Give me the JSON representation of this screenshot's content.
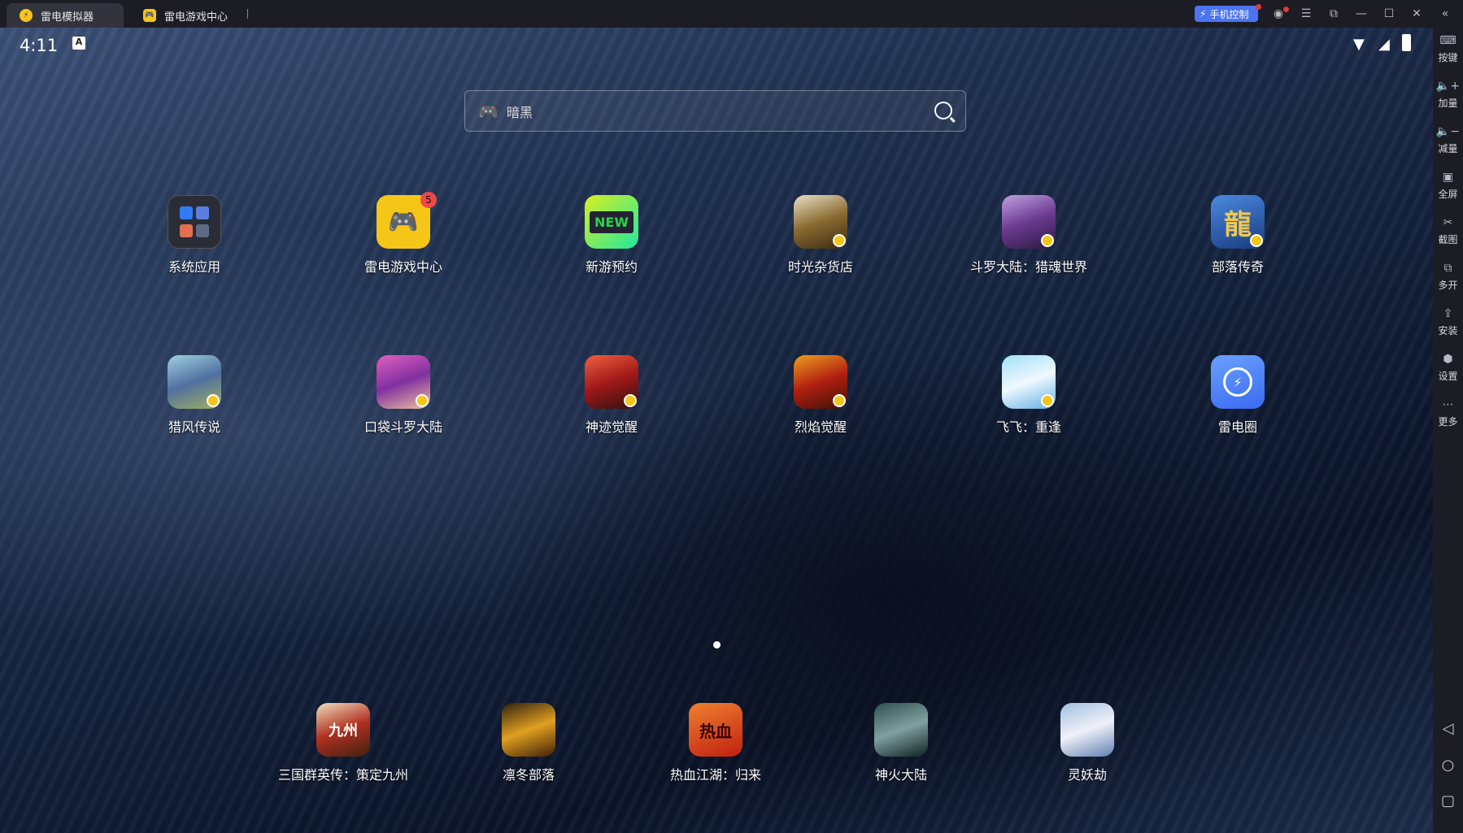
{
  "tabs": [
    {
      "label": "雷电模拟器",
      "icon": "leidian-logo-icon"
    },
    {
      "label": "雷电游戏中心",
      "icon": "gamepad-icon"
    }
  ],
  "titlebar": {
    "phone_control": "手机控制"
  },
  "status": {
    "time": "4:11"
  },
  "search": {
    "placeholder": "暗黑"
  },
  "apps": [
    {
      "label": "系统应用"
    },
    {
      "label": "雷电游戏中心",
      "badge": "5"
    },
    {
      "label": "新游预约",
      "icon_text": "NEW"
    },
    {
      "label": "时光杂货店"
    },
    {
      "label": "斗罗大陆：猎魂世界"
    },
    {
      "label": "部落传奇",
      "icon_text": "龍"
    },
    {
      "label": "猎风传说"
    },
    {
      "label": "口袋斗罗大陆"
    },
    {
      "label": "神迹觉醒"
    },
    {
      "label": "烈焰觉醒"
    },
    {
      "label": "飞飞：重逢"
    },
    {
      "label": "雷电圈"
    }
  ],
  "dock": [
    {
      "label": "三国群英传：策定九州",
      "icon_text": "九州"
    },
    {
      "label": "凛冬部落"
    },
    {
      "label": "热血江湖：归来",
      "icon_text": "热血"
    },
    {
      "label": "神火大陆"
    },
    {
      "label": "灵妖劫"
    }
  ],
  "sidebar": [
    "按键",
    "加量",
    "减量",
    "全屏",
    "截图",
    "多开",
    "安装",
    "设置",
    "更多"
  ]
}
